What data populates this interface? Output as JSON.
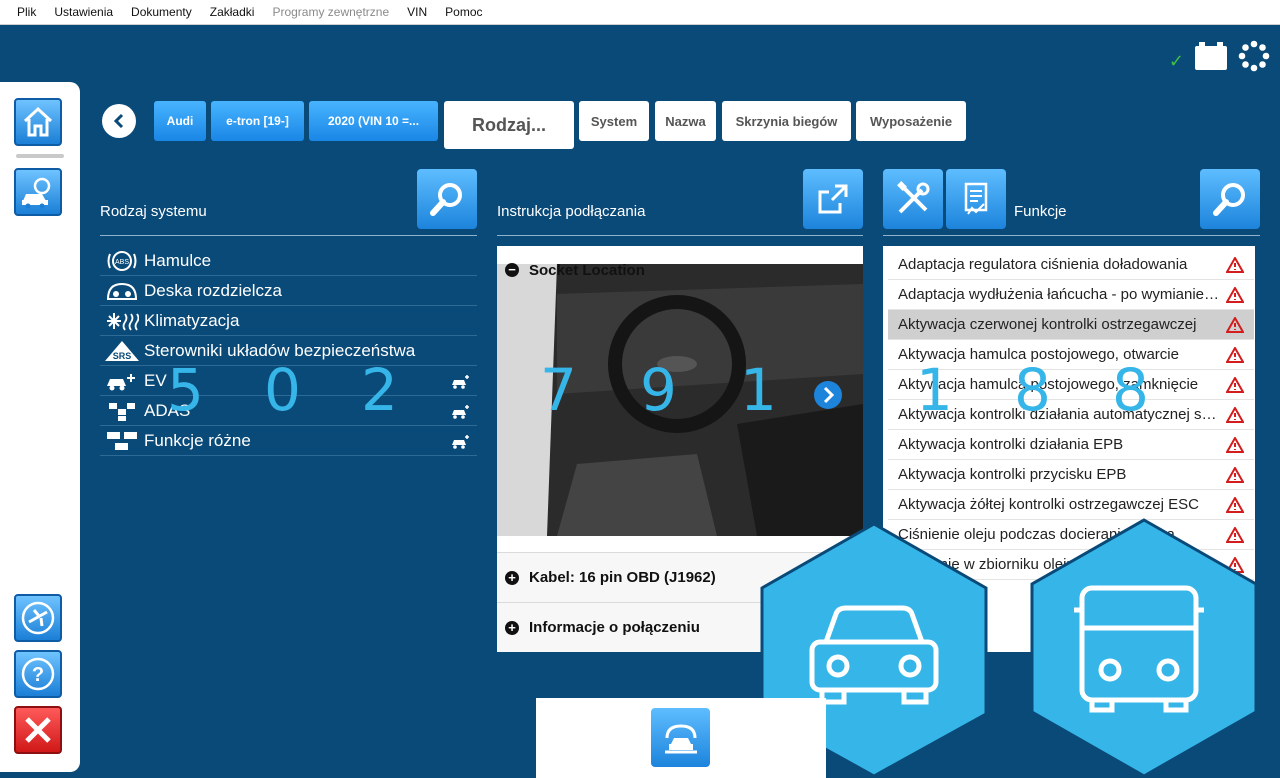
{
  "menu": [
    "Plik",
    "Ustawienia",
    "Dokumenty",
    "Zakładki",
    "Programy zewnętrzne",
    "VIN",
    "Pomoc"
  ],
  "status": {
    "check": "✓"
  },
  "breadcrumb": {
    "make": "Audi",
    "model": "e-tron [19-]",
    "year": "2020 (VIN 10 =...",
    "type": "Rodzaj...",
    "system": "System",
    "name": "Nazwa",
    "gearbox": "Skrzynia biegów",
    "equipment": "Wyposażenie"
  },
  "systems": {
    "title": "Rodzaj systemu",
    "items": [
      {
        "label": "Hamulce",
        "icon": "abs-icon"
      },
      {
        "label": "Deska rozdzielcza",
        "icon": "dashboard-icon"
      },
      {
        "label": "Klimatyzacja",
        "icon": "climate-icon"
      },
      {
        "label": "Sterowniki układów bezpieczeństwa",
        "icon": "srs-icon"
      },
      {
        "label": "EV",
        "icon": "ev-icon"
      },
      {
        "label": "ADAS",
        "icon": "adas-icon"
      },
      {
        "label": "Funkcje różne",
        "icon": "misc-icon"
      }
    ]
  },
  "connection": {
    "title": "Instrukcja podłączania",
    "socket": "Socket Location",
    "cable": "Kabel: 16 pin OBD (J1962)",
    "info": "Informacje o połączeniu"
  },
  "functions": {
    "title": "Funkcje",
    "items": [
      "Adaptacja regulatora ciśnienia doładowania",
      "Adaptacja wydłużenia łańcucha - po wymianie łańcucha",
      "Aktywacja czerwonej kontrolki ostrzegawczej",
      "Aktywacja hamulca postojowego, otwarcie",
      "Aktywacja hamulca postojowego, zamknięcie",
      "Aktywacja kontrolki działania automatycznej skrzyni",
      "Aktywacja kontrolki działania EPB",
      "Aktywacja kontrolki przycisku EPB",
      "Aktywacja żółtej kontrolki ostrzegawczej ESC",
      "Ciśnienie oleju podczas docierania silnika",
      "Ciśnienie w zbiorniku oleju"
    ]
  },
  "overlay": {
    "left_numbers": [
      "5",
      "0",
      "2"
    ],
    "middle_numbers": [
      "7",
      "9",
      "1"
    ],
    "right_numbers": [
      "1",
      "8",
      "8"
    ]
  },
  "colors": {
    "accent": "#36b6e8",
    "background": "#0a4a78",
    "button": "#1d84dc",
    "warning": "#d41c1c"
  }
}
